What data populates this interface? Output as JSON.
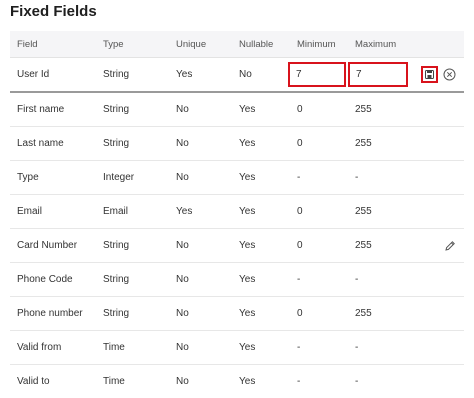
{
  "title": "Fixed Fields",
  "columns": {
    "field": "Field",
    "type": "Type",
    "unique": "Unique",
    "nullable": "Nullable",
    "minimum": "Minimum",
    "maximum": "Maximum"
  },
  "editing_row": {
    "field": "User Id",
    "type": "String",
    "unique": "Yes",
    "nullable": "No",
    "minimum": "7",
    "maximum": "7"
  },
  "rows": [
    {
      "field": "First name",
      "type": "String",
      "unique": "No",
      "nullable": "Yes",
      "minimum": "0",
      "maximum": "255"
    },
    {
      "field": "Last name",
      "type": "String",
      "unique": "No",
      "nullable": "Yes",
      "minimum": "0",
      "maximum": "255"
    },
    {
      "field": "Type",
      "type": "Integer",
      "unique": "No",
      "nullable": "Yes",
      "minimum": "-",
      "maximum": "-"
    },
    {
      "field": "Email",
      "type": "Email",
      "unique": "Yes",
      "nullable": "Yes",
      "minimum": "0",
      "maximum": "255"
    },
    {
      "field": "Card Number",
      "type": "String",
      "unique": "No",
      "nullable": "Yes",
      "minimum": "0",
      "maximum": "255"
    },
    {
      "field": "Phone Code",
      "type": "String",
      "unique": "No",
      "nullable": "Yes",
      "minimum": "-",
      "maximum": "-"
    },
    {
      "field": "Phone number",
      "type": "String",
      "unique": "No",
      "nullable": "Yes",
      "minimum": "0",
      "maximum": "255"
    },
    {
      "field": "Valid from",
      "type": "Time",
      "unique": "No",
      "nullable": "Yes",
      "minimum": "-",
      "maximum": "-"
    },
    {
      "field": "Valid to",
      "type": "Time",
      "unique": "No",
      "nullable": "Yes",
      "minimum": "-",
      "maximum": "-"
    }
  ],
  "icons": {
    "save": "save-icon",
    "cancel": "cancel-icon",
    "edit": "pencil-icon"
  },
  "colors": {
    "highlight": "#d8131c",
    "header_bg": "#f5f5f7",
    "icon": "#555555"
  }
}
